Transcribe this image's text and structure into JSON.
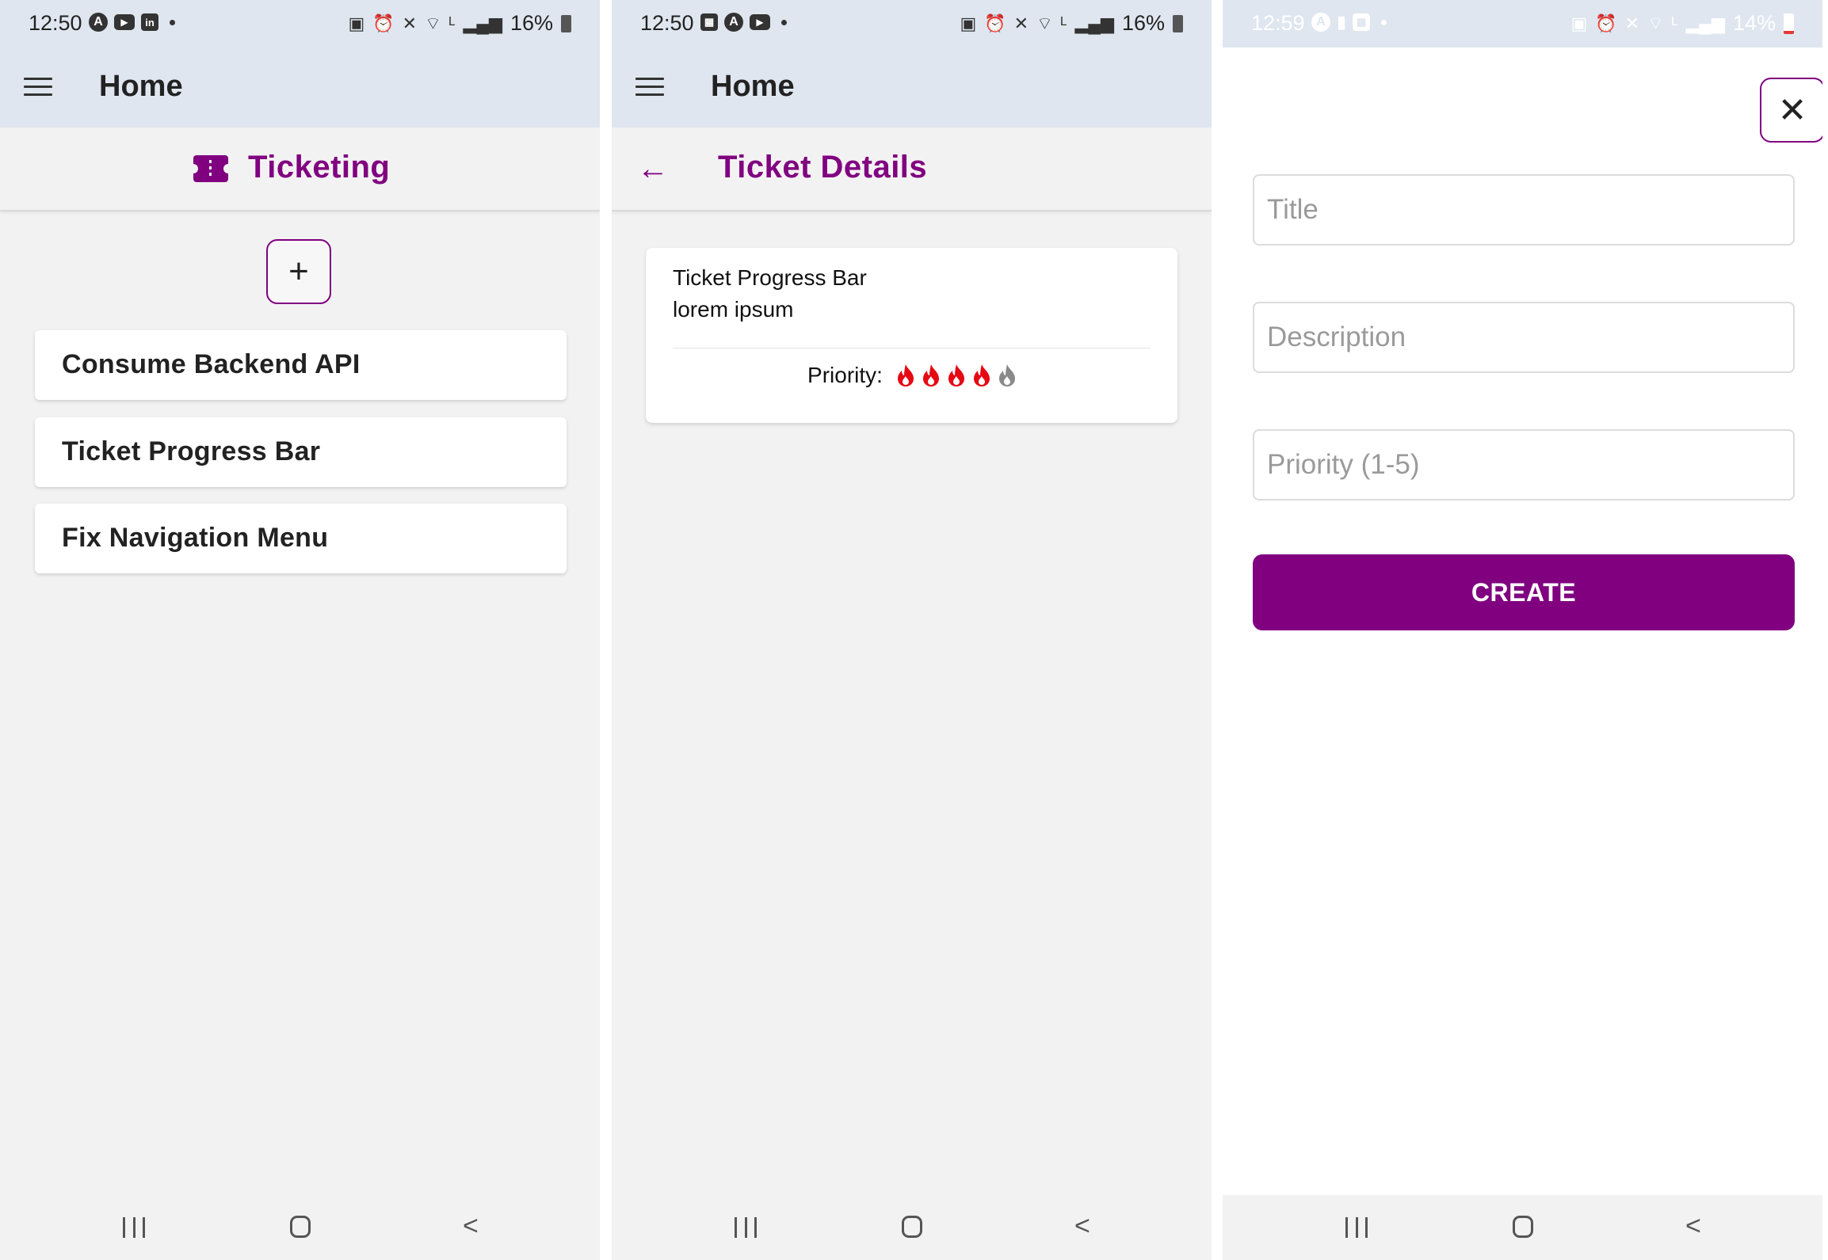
{
  "status_bars": [
    {
      "time": "12:50",
      "battery": "16%"
    },
    {
      "time": "12:50",
      "battery": "16%"
    },
    {
      "time": "12:59",
      "battery": "14%"
    }
  ],
  "home_screen": {
    "appbar_title": "Home",
    "section_title": "Ticketing",
    "add_label": "+",
    "tickets": [
      {
        "title": "Consume Backend API"
      },
      {
        "title": "Ticket Progress Bar"
      },
      {
        "title": "Fix Navigation Menu"
      }
    ]
  },
  "details_screen": {
    "appbar_title": "Home",
    "section_title": "Ticket Details",
    "ticket": {
      "title": "Ticket Progress Bar",
      "description": "lorem ipsum",
      "priority_label": "Priority:",
      "priority": 4,
      "priority_max": 5
    },
    "colors": {
      "flame_active": "#e50914",
      "flame_inactive": "#8a8a8a"
    }
  },
  "create_screen": {
    "close_label": "✕",
    "fields": {
      "title_placeholder": "Title",
      "description_placeholder": "Description",
      "priority_placeholder": "Priority (1-5)"
    },
    "create_label": "CREATE"
  },
  "colors": {
    "accent": "#800080",
    "appbar_bg": "#dfe6ef",
    "page_bg": "#f2f2f2"
  }
}
